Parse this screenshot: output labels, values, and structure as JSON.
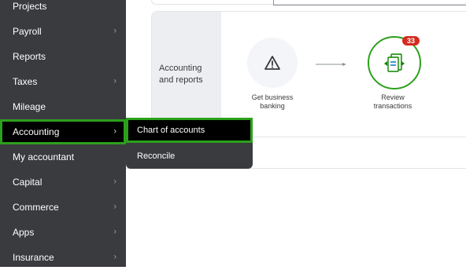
{
  "sidebar": {
    "items": [
      {
        "label": "Projects",
        "has_chevron": false
      },
      {
        "label": "Payroll",
        "has_chevron": true
      },
      {
        "label": "Reports",
        "has_chevron": false
      },
      {
        "label": "Taxes",
        "has_chevron": true
      },
      {
        "label": "Mileage",
        "has_chevron": false
      },
      {
        "label": "Accounting",
        "has_chevron": true,
        "active": true
      },
      {
        "label": "My accountant",
        "has_chevron": false
      },
      {
        "label": "Capital",
        "has_chevron": true
      },
      {
        "label": "Commerce",
        "has_chevron": true
      },
      {
        "label": "Apps",
        "has_chevron": true
      },
      {
        "label": "Insurance",
        "has_chevron": true
      }
    ],
    "chevron": "›"
  },
  "flyout": {
    "items": [
      {
        "label": "Chart of accounts",
        "active": true
      },
      {
        "label": "Reconcile",
        "active": false
      }
    ]
  },
  "panel": {
    "label": "Accounting and reports",
    "steps": [
      {
        "label": "Get business banking",
        "icon": "warning-icon"
      },
      {
        "label": "Review transactions",
        "icon": "transactions-icon",
        "badge": "33"
      }
    ]
  },
  "colors": {
    "sidebar_bg": "#3a3b3f",
    "active_outline": "#2ca01c",
    "badge_red": "#d52b1e"
  }
}
